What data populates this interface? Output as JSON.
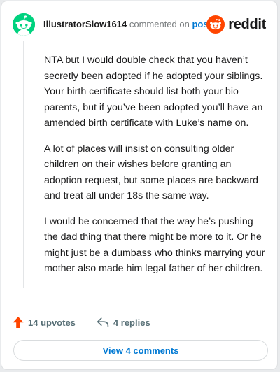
{
  "header": {
    "username": "IllustratorSlow1614",
    "verb": "commented on",
    "post_link": "post",
    "logo_text": "reddit"
  },
  "comment": {
    "paragraphs": [
      "NTA but I would double check that you haven’t secretly been adopted if he adopted your siblings. Your birth certificate should list both your bio parents, but if you’ve been adopted you’ll have an amended birth certificate with Luke’s name on.",
      "A lot of places will insist on consulting older children on their wishes before granting an adoption request, but some places are backward and treat all under 18s the same way.",
      "I would be concerned that the way he’s pushing the dad thing that there might be more to it. Or he might just be a dumbass who thinks marrying your mother also made him legal father of her children."
    ]
  },
  "actions": {
    "upvotes": "14 upvotes",
    "replies": "4 replies"
  },
  "view_button": "View 4 comments",
  "colors": {
    "avatar_bg": "#00d27f",
    "reddit_orange": "#ff4500",
    "link_blue": "#0079d3",
    "muted": "#576f76"
  },
  "icons": {
    "avatar": "snoo-avatar-icon",
    "logo": "reddit-logo-icon",
    "upvote": "upvote-arrow-icon",
    "reply": "reply-arrow-icon"
  }
}
